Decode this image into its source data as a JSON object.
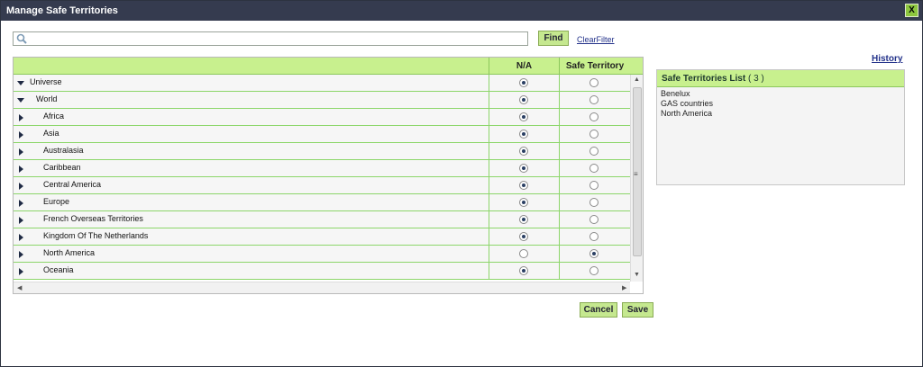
{
  "dialog": {
    "title": "Manage Safe Territories",
    "close_label": "X"
  },
  "search": {
    "value": "",
    "placeholder": "",
    "find_label": "Find",
    "clear_label": "ClearFilter"
  },
  "history_label": "History",
  "grid": {
    "columns": [
      "N/A",
      "Safe Territory"
    ],
    "rows": [
      {
        "label": "Universe",
        "level": 0,
        "expanded": true,
        "selected": "N/A"
      },
      {
        "label": "World",
        "level": 1,
        "expanded": true,
        "selected": "N/A"
      },
      {
        "label": "Africa",
        "level": 2,
        "expanded": false,
        "selected": "N/A"
      },
      {
        "label": "Asia",
        "level": 2,
        "expanded": false,
        "selected": "N/A"
      },
      {
        "label": "Australasia",
        "level": 2,
        "expanded": false,
        "selected": "N/A"
      },
      {
        "label": "Caribbean",
        "level": 2,
        "expanded": false,
        "selected": "N/A"
      },
      {
        "label": "Central America",
        "level": 2,
        "expanded": false,
        "selected": "N/A"
      },
      {
        "label": "Europe",
        "level": 2,
        "expanded": false,
        "selected": "N/A"
      },
      {
        "label": "French Overseas Territories",
        "level": 2,
        "expanded": false,
        "selected": "N/A"
      },
      {
        "label": "Kingdom Of The Netherlands",
        "level": 2,
        "expanded": false,
        "selected": "N/A"
      },
      {
        "label": "North America",
        "level": 2,
        "expanded": false,
        "selected": "Safe Territory"
      },
      {
        "label": "Oceania",
        "level": 2,
        "expanded": false,
        "selected": "N/A"
      }
    ]
  },
  "buttons": {
    "cancel": "Cancel",
    "save": "Save"
  },
  "safe_list": {
    "title": "Safe Territories List",
    "count": "( 3 )",
    "items": [
      "Benelux",
      "GAS countries",
      "North America"
    ]
  },
  "colors": {
    "titlebar": "#353b4f",
    "header_green": "#c8f08e",
    "row_border_green": "#8cd66a",
    "button_green": "#c5e88f",
    "link_blue": "#23328a"
  },
  "icons": {
    "search": "search-icon",
    "expanded": "triangle-down-icon",
    "collapsed": "triangle-right-icon"
  }
}
